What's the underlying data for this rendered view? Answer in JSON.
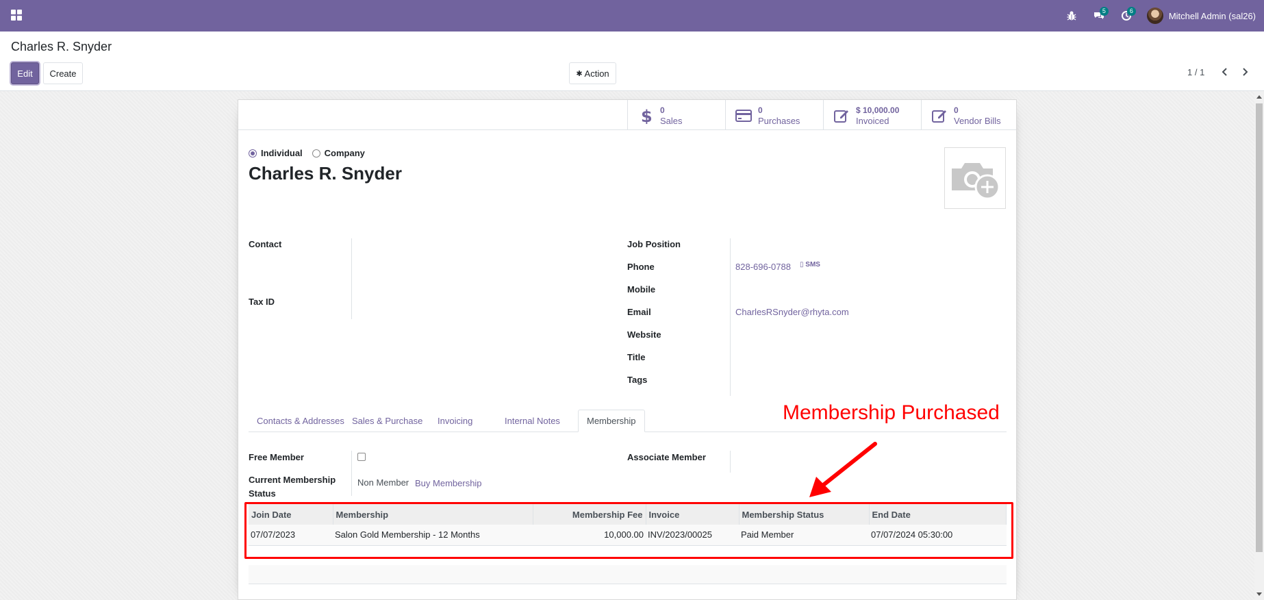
{
  "navbar": {
    "chat_badge": "5",
    "activity_badge": "6",
    "user_name": "Mitchell Admin (sal26)"
  },
  "control_panel": {
    "title": "Charles R. Snyder",
    "edit_label": "Edit",
    "create_label": "Create",
    "action_label": "Action",
    "pager": "1 / 1"
  },
  "stats": [
    {
      "icon": "dollar-icon",
      "value": "0",
      "label": "Sales"
    },
    {
      "icon": "credit-card-icon",
      "value": "0",
      "label": "Purchases"
    },
    {
      "icon": "pencil-square-icon",
      "value": "$ 10,000.00",
      "label": "Invoiced"
    },
    {
      "icon": "pencil-square-icon",
      "value": "0",
      "label": "Vendor Bills"
    }
  ],
  "partner": {
    "type_individual": "Individual",
    "type_company": "Company",
    "name": "Charles R. Snyder"
  },
  "left_fields": {
    "contact_label": "Contact",
    "tax_id_label": "Tax ID"
  },
  "right_fields": {
    "job_position_label": "Job Position",
    "phone_label": "Phone",
    "phone_value": "828-696-0788",
    "sms_label": "SMS",
    "mobile_label": "Mobile",
    "email_label": "Email",
    "email_value": "CharlesRSnyder@rhyta.com",
    "website_label": "Website",
    "title_label": "Title",
    "tags_label": "Tags"
  },
  "tabs": [
    "Contacts & Addresses",
    "Sales & Purchase",
    "Invoicing",
    "Internal Notes",
    "Membership"
  ],
  "membership": {
    "free_member_label": "Free Member",
    "associate_member_label": "Associate Member",
    "current_status_label_1": "Current Membership",
    "current_status_label_2": "Status",
    "current_status_value": "Non Member",
    "buy_membership_label": "Buy Membership",
    "columns": [
      "Join Date",
      "Membership",
      "Membership Fee",
      "Invoice",
      "Membership Status",
      "End Date"
    ],
    "rows": [
      [
        "07/07/2023",
        "Salon Gold Membership - 12 Months",
        "10,000.00",
        "INV/2023/00025",
        "Paid Member",
        "07/07/2024 05:30:00"
      ]
    ]
  },
  "annotation": {
    "text": "Membership Purchased",
    "color": "#ff0000"
  },
  "colors": {
    "brand": "#71639e",
    "badge": "#017e84"
  }
}
